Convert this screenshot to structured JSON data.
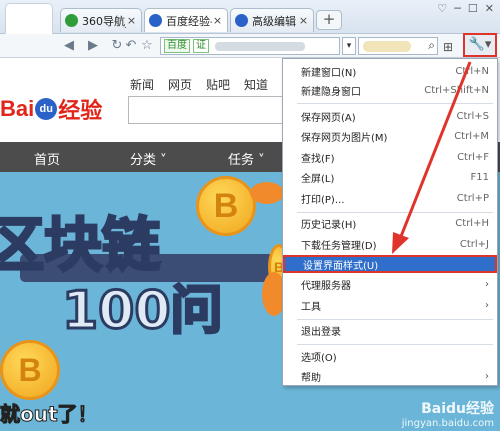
{
  "tabs": [
    {
      "label": "360导航_",
      "icon": "360-nav-icon",
      "color": "#2e9d3a"
    },
    {
      "label": "百度经验-",
      "icon": "baidu-paw-icon",
      "color": "#2b62c8"
    },
    {
      "label": "高级编辑",
      "icon": "baidu-paw-icon",
      "color": "#2b62c8"
    }
  ],
  "tab_close": "×",
  "new_tab": "+",
  "window_buttons": [
    "♡",
    "─",
    "☐",
    "✕"
  ],
  "address": {
    "site": "百度",
    "cert": "证"
  },
  "page_nav": [
    "新闻",
    "网页",
    "贴吧",
    "知道"
  ],
  "logo": {
    "bai": "Bai",
    "du": "du",
    "jingyan": "经验"
  },
  "categories": [
    "首页",
    "分类",
    "任务"
  ],
  "banner": {
    "line1": "区块链",
    "line2": "100问",
    "bottom": "就out了！",
    "watermark1": "Baidu经验",
    "watermark2": "jingyan.baidu.com"
  },
  "menu": {
    "items": [
      {
        "label": "新建窗口(N)",
        "shortcut": "Ctrl+N"
      },
      {
        "label": "新建隐身窗口",
        "shortcut": "Ctrl+Shift+N"
      },
      {
        "label": "保存网页(A)",
        "shortcut": "Ctrl+S"
      },
      {
        "label": "保存网页为图片(M)",
        "shortcut": "Ctrl+M"
      },
      {
        "label": "查找(F)",
        "shortcut": "Ctrl+F"
      },
      {
        "label": "全屏(L)",
        "shortcut": "F11"
      },
      {
        "label": "打印(P)...",
        "shortcut": "Ctrl+P"
      },
      {
        "label": "历史记录(H)",
        "shortcut": "Ctrl+H"
      },
      {
        "label": "下载任务管理(D)",
        "shortcut": "Ctrl+J"
      },
      {
        "label": "设置界面样式(U)",
        "shortcut": ""
      },
      {
        "label": "代理服务器",
        "shortcut": "",
        "submenu": true
      },
      {
        "label": "工具",
        "shortcut": "",
        "submenu": true
      },
      {
        "label": "退出登录",
        "shortcut": ""
      },
      {
        "label": "选项(O)",
        "shortcut": ""
      },
      {
        "label": "帮助",
        "shortcut": "",
        "submenu": true
      }
    ]
  },
  "colors": {
    "highlight": "#2f6fcb",
    "annotation_red": "#e0332b",
    "brand_red": "#e1251b",
    "brand_blue": "#2b62c8"
  }
}
